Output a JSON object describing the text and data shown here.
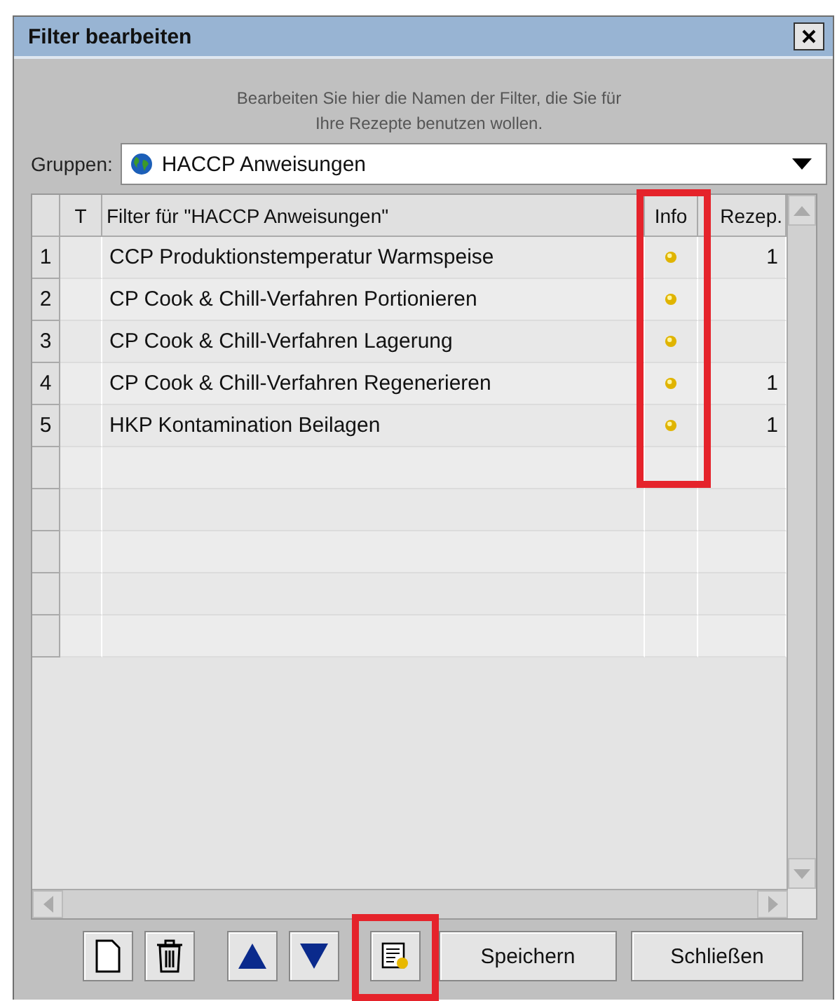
{
  "window": {
    "title": "Filter bearbeiten"
  },
  "instructions": [
    "Bearbeiten Sie hier die Namen der Filter, die Sie für",
    "Ihre Rezepte benutzen wollen."
  ],
  "group": {
    "label": "Gruppen:",
    "value": "HACCP Anweisungen"
  },
  "table": {
    "columns": [
      "T",
      "Filter für \"HACCP Anweisungen\"",
      "Info",
      "Rezep."
    ],
    "rows": [
      {
        "number": "1",
        "name": "CCP Produktionstemperatur Warmspeise",
        "info": true,
        "recipes": "1"
      },
      {
        "number": "2",
        "name": "CP Cook & Chill-Verfahren Portionieren",
        "info": true
      },
      {
        "number": "3",
        "name": "CP Cook & Chill-Verfahren Lagerung",
        "info": true
      },
      {
        "number": "4",
        "name": "CP Cook & Chill-Verfahren Regenerieren",
        "info": true,
        "recipes": "1"
      },
      {
        "number": "5",
        "name": "HKP Kontamination Beilagen",
        "info": true,
        "recipes": "1"
      }
    ]
  },
  "buttons": [
    "Speichern",
    "Schließen"
  ]
}
